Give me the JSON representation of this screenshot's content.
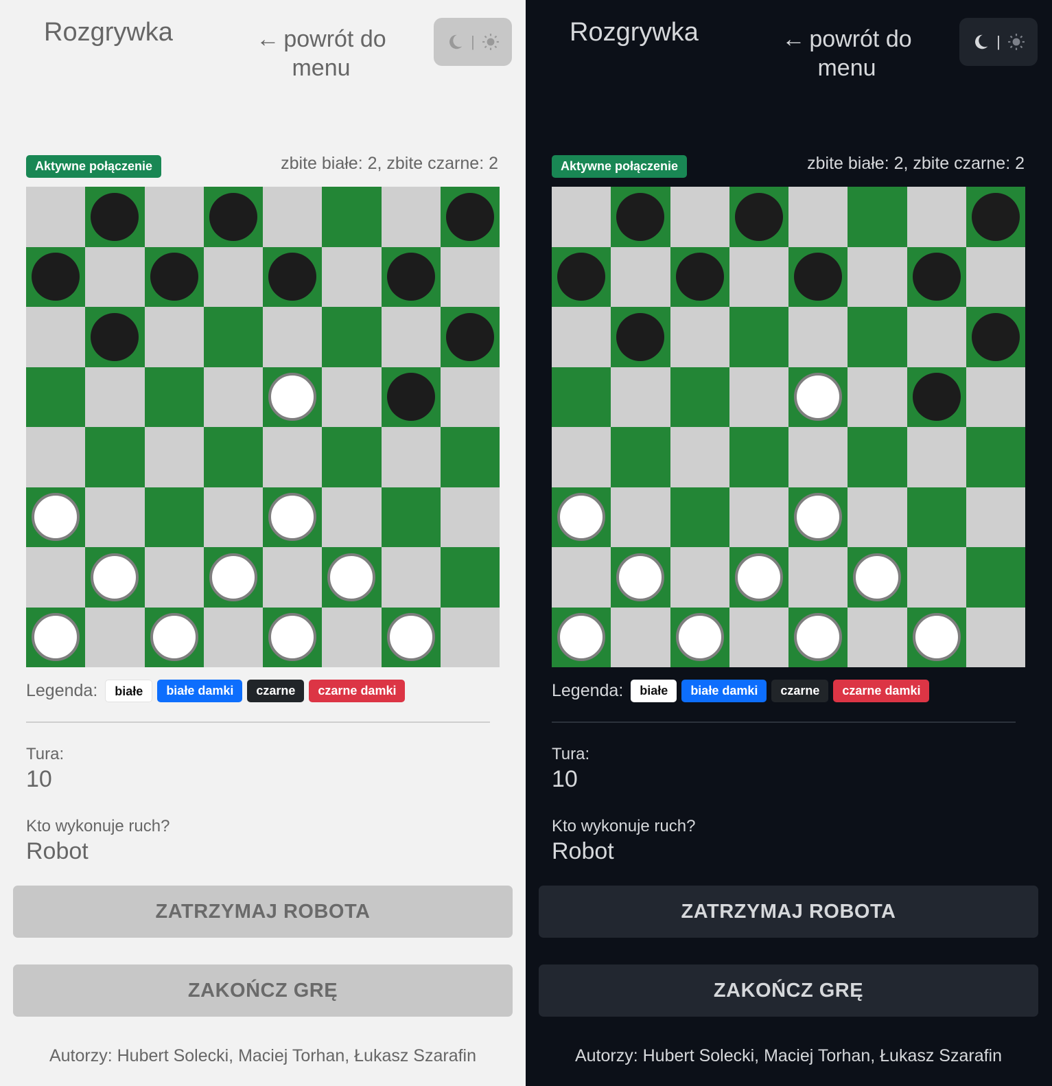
{
  "header": {
    "title": "Rozgrywka",
    "back_arrow": "←",
    "back_label": "powrót do menu",
    "moon_icon": "moon-icon",
    "separator": "|",
    "sun_icon": "sun-icon"
  },
  "status": {
    "connection": "Aktywne połączenie",
    "captured": "zbite białe: 2, zbite czarne: 2"
  },
  "board_states": {
    "light": [
      ".b.b...b",
      "b.b.b.b.",
      ".b.....b",
      "....w.b.",
      "........",
      "w...w...",
      ".w.w.w..",
      "w.w.w.w."
    ],
    "dark": [
      ".b.b...b",
      "b.b.b.b.",
      ".b.....b",
      "....w.b.",
      "........",
      "w...w...",
      ".w.w.w..",
      "w.w.w.w."
    ]
  },
  "legend": {
    "label": "Legenda:",
    "white": "białe",
    "white_kings": "białe damki",
    "black": "czarne",
    "black_kings": "czarne damki"
  },
  "turn": {
    "label": "Tura:",
    "value": "10"
  },
  "mover": {
    "label": "Kto wykonuje ruch?",
    "value": "Robot"
  },
  "buttons": {
    "stop_robot": "ZATRZYMAJ ROBOTA",
    "end_game": "ZAKOŃCZ GRĘ"
  },
  "footer": {
    "authors": "Autorzy: Hubert Solecki, Maciej Torhan, Łukasz Szarafin"
  },
  "colors": {
    "board_green": "#238636",
    "board_light": "#cfcfcf",
    "badge_green": "#198754",
    "white_kings": "#0d6efd",
    "black_kings": "#dc3545",
    "light_bg": "#f2f2f2",
    "dark_bg": "#0c1018"
  }
}
